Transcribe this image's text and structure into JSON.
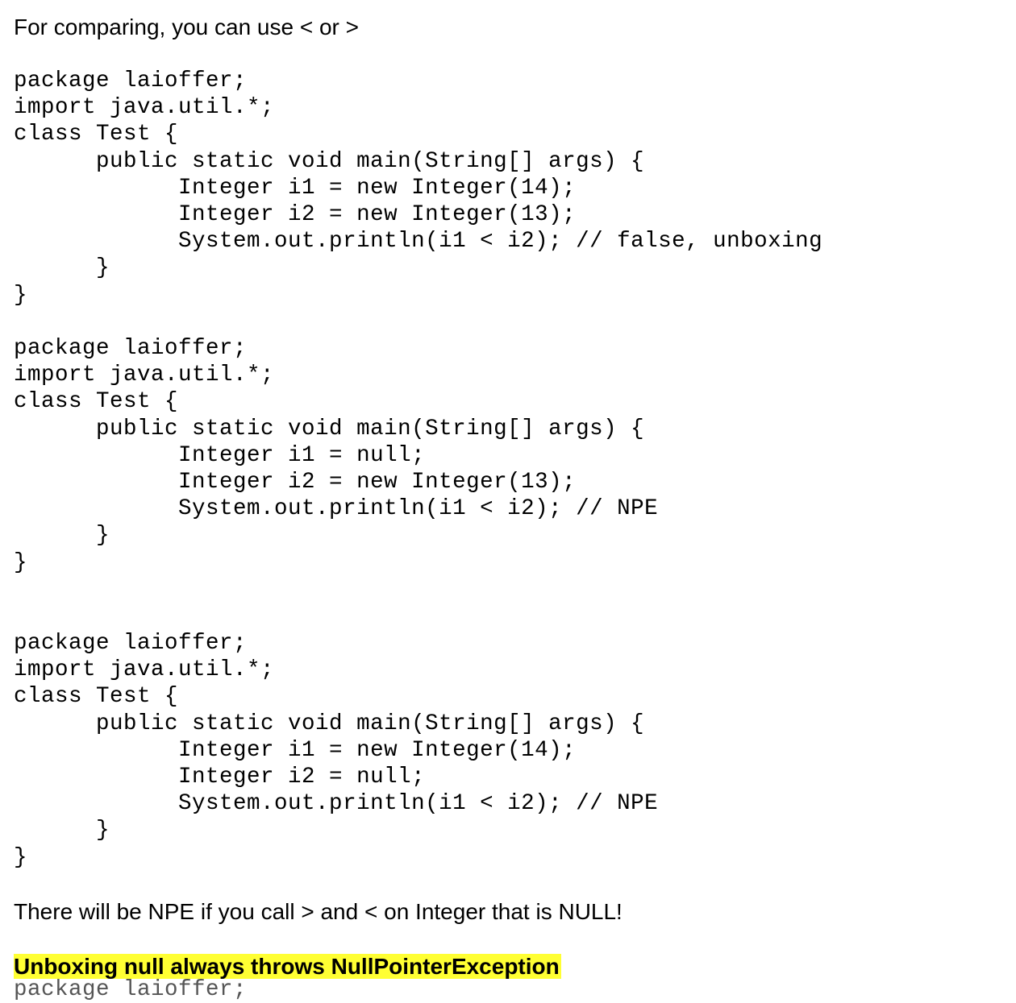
{
  "intro_text": "For comparing, you can use < or >",
  "code_blocks": [
    {
      "lines": [
        "package laioffer;",
        "import java.util.*;",
        "class Test {",
        "      public static void main(String[] args) {",
        "            Integer i1 = new Integer(14);",
        "            Integer i2 = new Integer(13);",
        "            System.out.println(i1 < i2); // false, unboxing",
        "      }",
        "}"
      ]
    },
    {
      "lines": [
        "package laioffer;",
        "import java.util.*;",
        "class Test {",
        "      public static void main(String[] args) {",
        "            Integer i1 = null;",
        "            Integer i2 = new Integer(13);",
        "            System.out.println(i1 < i2); // NPE",
        "      }",
        "}"
      ]
    },
    {
      "lines": [
        "package laioffer;",
        "import java.util.*;",
        "class Test {",
        "      public static void main(String[] args) {",
        "            Integer i1 = new Integer(14);",
        "            Integer i2 = null;",
        "            System.out.println(i1 < i2); // NPE",
        "      }",
        "}"
      ]
    }
  ],
  "npe_note": "There will be NPE if you call > and < on Integer that is NULL!",
  "highlight_text": "Unboxing null always throws NullPointerException",
  "highlight_color": "#ffff33",
  "cutoff_line": "package laioffer;"
}
